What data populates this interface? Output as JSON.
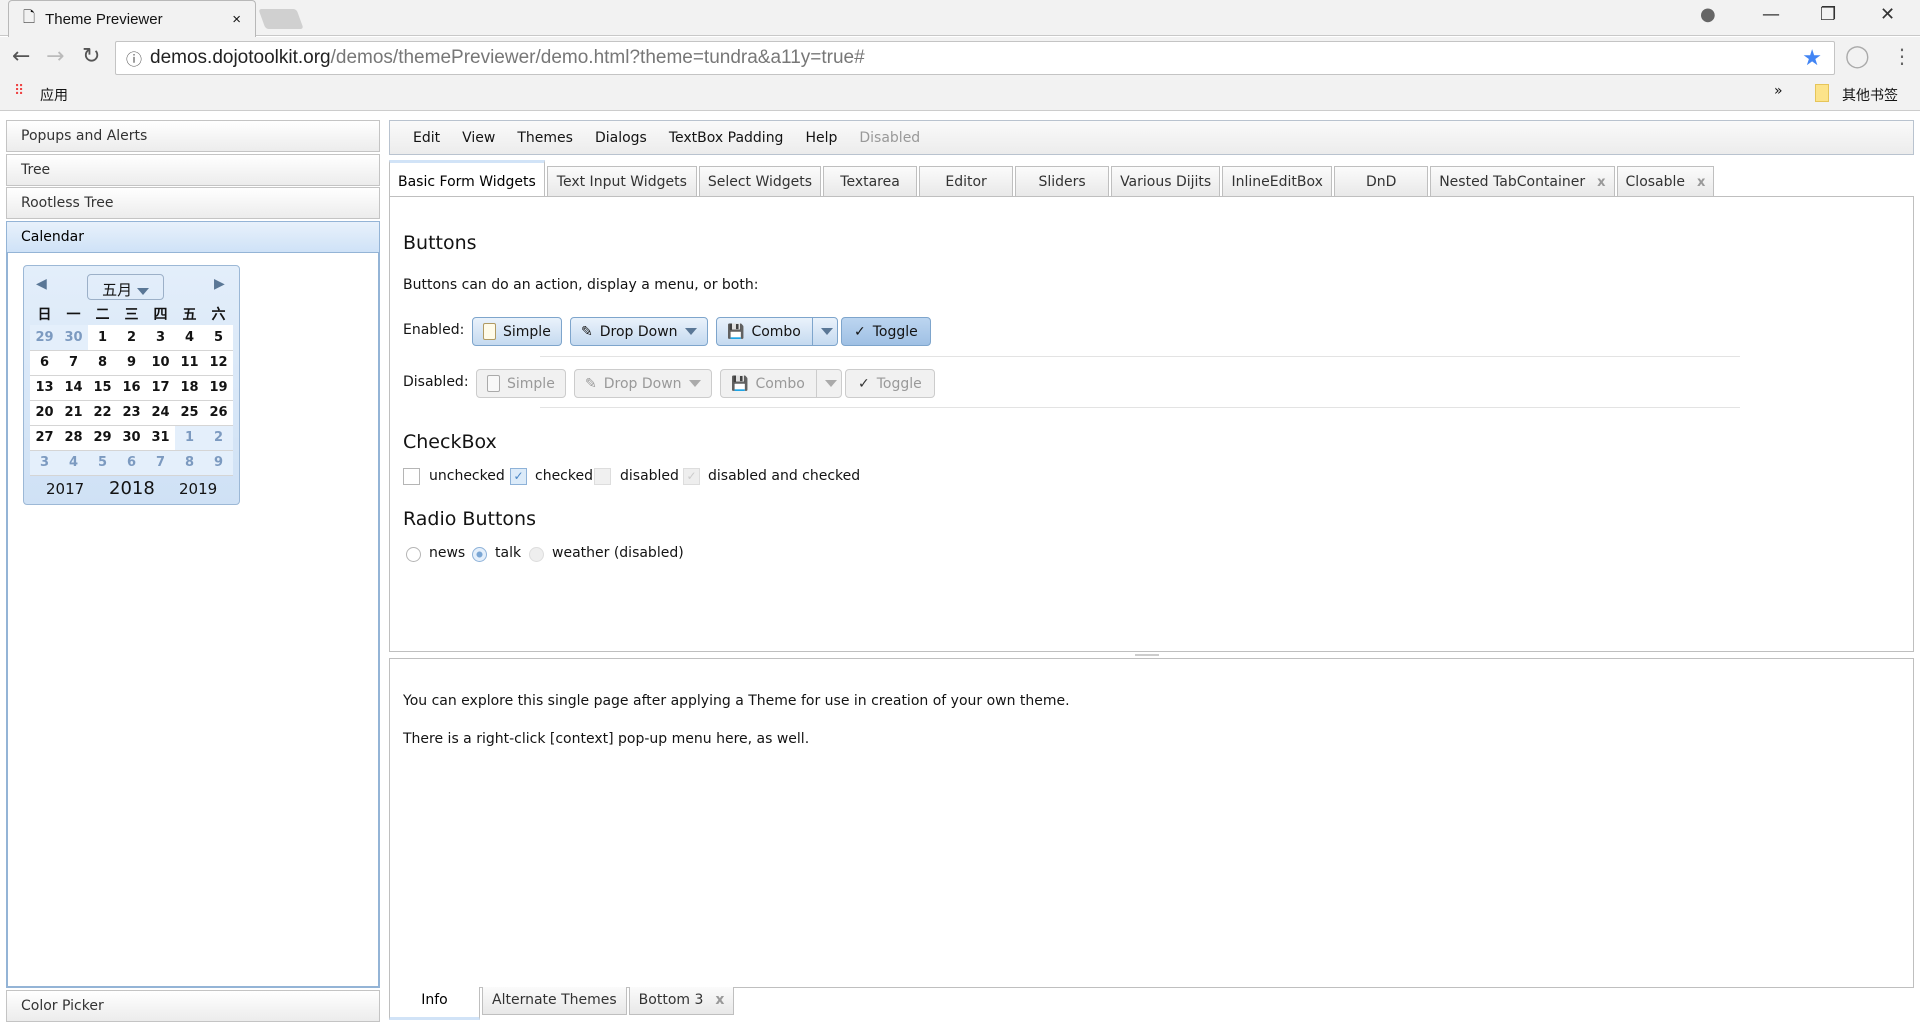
{
  "browser": {
    "tab_title": "Theme Previewer",
    "url_host": "demos.dojotoolkit.org",
    "url_path": "/demos/themePreviewer/demo.html?theme=tundra&a11y=true#",
    "apps_label": "应用",
    "other_bookmarks": "其他书签",
    "more": "»"
  },
  "sidebar": {
    "items": [
      {
        "label": "Popups and Alerts"
      },
      {
        "label": "Tree"
      },
      {
        "label": "Rootless Tree"
      },
      {
        "label": "Calendar"
      },
      {
        "label": "Color Picker"
      }
    ]
  },
  "calendar": {
    "month": "五月",
    "weekdays": [
      "日",
      "一",
      "二",
      "三",
      "四",
      "五",
      "六"
    ],
    "weeks": [
      [
        "29",
        "30",
        "1",
        "2",
        "3",
        "4",
        "5"
      ],
      [
        "6",
        "7",
        "8",
        "9",
        "10",
        "11",
        "12"
      ],
      [
        "13",
        "14",
        "15",
        "16",
        "17",
        "18",
        "19"
      ],
      [
        "20",
        "21",
        "22",
        "23",
        "24",
        "25",
        "26"
      ],
      [
        "27",
        "28",
        "29",
        "30",
        "31",
        "1",
        "2"
      ],
      [
        "3",
        "4",
        "5",
        "6",
        "7",
        "8",
        "9"
      ]
    ],
    "prev_year": "2017",
    "year": "2018",
    "next_year": "2019"
  },
  "menubar": [
    "Edit",
    "View",
    "Themes",
    "Dialogs",
    "TextBox Padding",
    "Help",
    "Disabled"
  ],
  "tabs": [
    {
      "label": "Basic Form Widgets"
    },
    {
      "label": "Text Input Widgets"
    },
    {
      "label": "Select Widgets"
    },
    {
      "label": "Textarea"
    },
    {
      "label": "Editor"
    },
    {
      "label": "Sliders"
    },
    {
      "label": "Various Dijits"
    },
    {
      "label": "InlineEditBox"
    },
    {
      "label": "DnD"
    },
    {
      "label": "Nested TabContainer",
      "closable": true
    },
    {
      "label": "Closable",
      "closable": true
    }
  ],
  "buttons": {
    "heading": "Buttons",
    "desc": "Buttons can do an action, display a menu, or both:",
    "enabled_label": "Enabled:",
    "disabled_label": "Disabled:",
    "simple": "Simple",
    "dropdown": "Drop Down",
    "combo": "Combo",
    "toggle": "Toggle",
    "check": "✓"
  },
  "checkbox": {
    "heading": "CheckBox",
    "unchecked": "unchecked",
    "checked": "checked",
    "disabled": "disabled",
    "disabled_checked": "disabled and checked"
  },
  "radio": {
    "heading": "Radio Buttons",
    "news": "news",
    "talk": "talk",
    "weather": "weather (disabled)"
  },
  "info": {
    "line1": "You can explore this single page after applying a Theme for use in creation of your own theme.",
    "line2": "There is a right-click [context] pop-up menu here, as well."
  },
  "bottom_tabs": [
    {
      "label": "Info"
    },
    {
      "label": "Alternate Themes"
    },
    {
      "label": "Bottom 3",
      "closable": true
    }
  ],
  "close_glyph": "x"
}
